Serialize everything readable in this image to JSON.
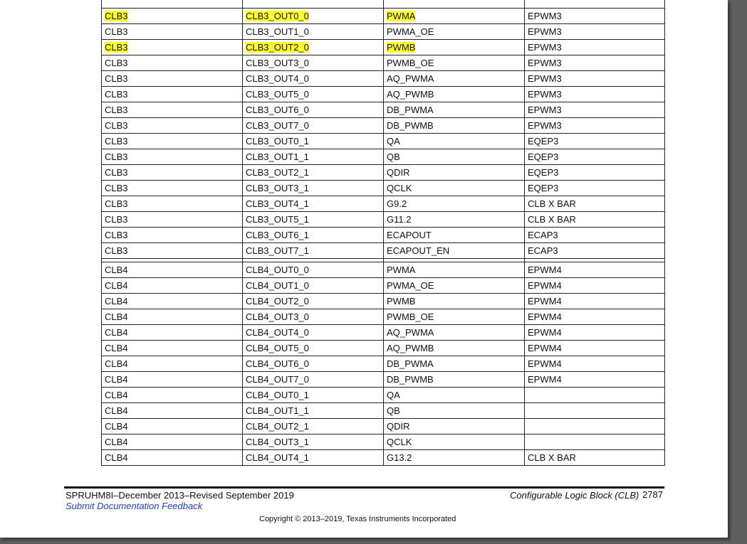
{
  "table": {
    "rows": [
      [
        "",
        "",
        "",
        ""
      ],
      [
        "CLB3",
        "CLB3_OUT0_0",
        "PWMA",
        "EPWM3"
      ],
      [
        "CLB3",
        "CLB3_OUT1_0",
        "PWMA_OE",
        "EPWM3"
      ],
      [
        "CLB3",
        "CLB3_OUT2_0",
        "PWMB",
        "EPWM3"
      ],
      [
        "CLB3",
        "CLB3_OUT3_0",
        "PWMB_OE",
        "EPWM3"
      ],
      [
        "CLB3",
        "CLB3_OUT4_0",
        "AQ_PWMA",
        "EPWM3"
      ],
      [
        "CLB3",
        "CLB3_OUT5_0",
        "AQ_PWMB",
        "EPWM3"
      ],
      [
        "CLB3",
        "CLB3_OUT6_0",
        "DB_PWMA",
        "EPWM3"
      ],
      [
        "CLB3",
        "CLB3_OUT7_0",
        "DB_PWMB",
        "EPWM3"
      ],
      [
        "CLB3",
        "CLB3_OUT0_1",
        "QA",
        "EQEP3"
      ],
      [
        "CLB3",
        "CLB3_OUT1_1",
        "QB",
        "EQEP3"
      ],
      [
        "CLB3",
        "CLB3_OUT2_1",
        "QDIR",
        "EQEP3"
      ],
      [
        "CLB3",
        "CLB3_OUT3_1",
        "QCLK",
        "EQEP3"
      ],
      [
        "CLB3",
        "CLB3_OUT4_1",
        "G9.2",
        "CLB X BAR"
      ],
      [
        "CLB3",
        "CLB3_OUT5_1",
        "G11.2",
        "CLB X BAR"
      ],
      [
        "CLB3",
        "CLB3_OUT6_1",
        "ECAPOUT",
        "ECAP3"
      ],
      [
        "CLB3",
        "CLB3_OUT7_1",
        "ECAPOUT_EN",
        "ECAP3"
      ],
      [
        "CLB4",
        "CLB4_OUT0_0",
        "PWMA",
        "EPWM4"
      ],
      [
        "CLB4",
        "CLB4_OUT1_0",
        "PWMA_OE",
        "EPWM4"
      ],
      [
        "CLB4",
        "CLB4_OUT2_0",
        "PWMB",
        "EPWM4"
      ],
      [
        "CLB4",
        "CLB4_OUT3_0",
        "PWMB_OE",
        "EPWM4"
      ],
      [
        "CLB4",
        "CLB4_OUT4_0",
        "AQ_PWMA",
        "EPWM4"
      ],
      [
        "CLB4",
        "CLB4_OUT5_0",
        "AQ_PWMB",
        "EPWM4"
      ],
      [
        "CLB4",
        "CLB4_OUT6_0",
        "DB_PWMA",
        "EPWM4"
      ],
      [
        "CLB4",
        "CLB4_OUT7_0",
        "DB_PWMB",
        "EPWM4"
      ],
      [
        "CLB4",
        "CLB4_OUT0_1",
        "QA",
        ""
      ],
      [
        "CLB4",
        "CLB4_OUT1_1",
        "QB",
        ""
      ],
      [
        "CLB4",
        "CLB4_OUT2_1",
        "QDIR",
        ""
      ],
      [
        "CLB4",
        "CLB4_OUT3_1",
        "QCLK",
        ""
      ],
      [
        "CLB4",
        "CLB4_OUT4_1",
        "G13.2",
        "CLB X BAR"
      ]
    ],
    "highlight_color": "#ffff29"
  },
  "footer": {
    "doc_id": "SPRUHM8I–December 2013–Revised September 2019",
    "feedback_link": "Submit Documentation Feedback",
    "section_title": "Configurable Logic Block (CLB)",
    "page_number": "2787",
    "copyright": "Copyright © 2013–2019, Texas Instruments Incorporated",
    "link_color": "#1f3fd0"
  }
}
